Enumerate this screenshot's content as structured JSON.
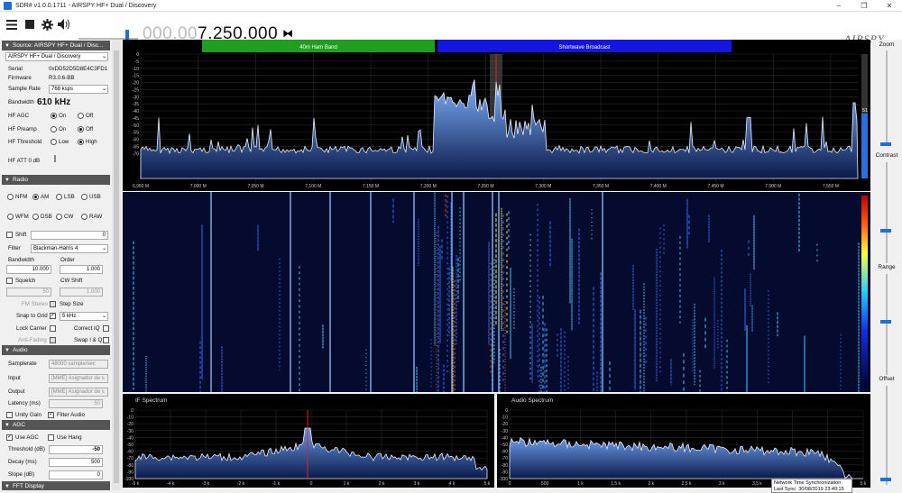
{
  "window": {
    "title": "SDR# v1.0.0.1711 - AIRSPY HF+ Dual / Discovery",
    "min": "–",
    "max": "❐",
    "close": "✕"
  },
  "toolbar": {
    "freq_dim": "000.00",
    "freq_lit": "7.250.000",
    "logo": "AIRSPY"
  },
  "source": {
    "header": "Source: AIRSPY HF+ Dual / Disc...",
    "device": "AIRSPY HF+ Dual / Discovery",
    "serial_label": "Serial",
    "serial": "0xDD52D5D8E4C3FD1",
    "firmware_label": "Firmware",
    "firmware": "R3.0.6-BB",
    "samplerate_label": "Sample Rate",
    "samplerate": "768 ksps",
    "bandwidth_label": "Bandwidth",
    "bandwidth": "610 kHz",
    "agc_label": "HF AGC",
    "preamp_label": "HF Preamp",
    "threshold_label": "HF Threshold",
    "on": "On",
    "off": "Off",
    "low": "Low",
    "high": "High",
    "att_label": "HF ATT 0 dB"
  },
  "radio": {
    "header": "Radio",
    "modes_row1": [
      "NFM",
      "AM",
      "LSB",
      "USB"
    ],
    "modes_row2": [
      "WFM",
      "DSB",
      "CW",
      "RAW"
    ],
    "shift_label": "Shift",
    "shift_value": "0",
    "filter_label": "Filter",
    "filter": "Blackman-Harris 4",
    "bandwidth_label": "Bandwidth",
    "bandwidth": "10.000",
    "order_label": "Order",
    "order": "1.000",
    "squelch_label": "Squelch",
    "squelch": "50",
    "cwshift_label": "CW Shift",
    "cwshift": "1.000",
    "fmstereo_label": "FM Stereo",
    "stepsize_label": "Step Size",
    "snap_label": "Snap to Grid",
    "step": "5 kHz",
    "lockcarrier_label": "Lock Carrier",
    "correctiq_label": "Correct IQ",
    "antifading_label": "Anti-Fading",
    "swapiq_label": "Swap I & Q"
  },
  "audio": {
    "header": "Audio",
    "samplerate_label": "Samplerate",
    "samplerate": "48000 sample/sec",
    "input_label": "Input",
    "input": "[MME] Asignador de s",
    "output_label": "Output",
    "output": "[MME] Asignador de s",
    "latency_label": "Latency (ms)",
    "latency": "50",
    "unity_label": "Unity Gain",
    "filteraudio_label": "Filter Audio"
  },
  "agc": {
    "header": "AGC",
    "useagc_label": "Use AGC",
    "usehang_label": "Use Hang",
    "threshold_label": "Threshold (dB)",
    "threshold": "-50",
    "decay_label": "Decay (ms)",
    "decay": "500",
    "slope_label": "Slope (dB)",
    "slope": "0"
  },
  "fft": {
    "header": "FFT Display"
  },
  "right": {
    "zoom": "Zoom",
    "contrast": "Contrast",
    "range": "Range",
    "offset": "Offset"
  },
  "spectrum": {
    "bands": [
      {
        "name": "40m Ham Band",
        "color": "#1f9e1f"
      },
      {
        "name": "Shortwave Broadcast",
        "color": "#1515e0"
      }
    ],
    "y_ticks": [
      "0",
      "-5",
      "-10",
      "-15",
      "-20",
      "-25",
      "-30",
      "-35",
      "-40",
      "-45",
      "-50",
      "-55",
      "-60",
      "-65",
      "-70"
    ],
    "x_ticks": [
      "6,950 M",
      "7,000 M",
      "7,050 M",
      "7,100 M",
      "7,150 M",
      "7,200 M",
      "7,250 M",
      "7,300 M",
      "7,350 M",
      "7,400 M",
      "7,450 M",
      "7,500 M",
      "7,550 M"
    ],
    "level_value": "51"
  },
  "if_spectrum": {
    "title": "IF Spectrum",
    "y_ticks": [
      "0",
      "-10",
      "-20",
      "-30",
      "-40",
      "-50",
      "-60",
      "-70",
      "-80",
      "-90",
      "-100"
    ],
    "x_ticks": [
      "-5 k",
      "-4 k",
      "-3 k",
      "-2 k",
      "-1 k",
      "0",
      "1 k",
      "2 k",
      "3 k",
      "4 k",
      "5 k"
    ]
  },
  "audio_spectrum": {
    "title": "Audio Spectrum",
    "y_ticks": [
      "0",
      "-10",
      "-20",
      "-30",
      "-40",
      "-50",
      "-60",
      "-70",
      "-80",
      "-90",
      "-100"
    ],
    "x_ticks": [
      "0",
      "500",
      "1 k",
      "1,5 k",
      "2 k",
      "2,5 k",
      "3 k",
      "3,5 k",
      "4 k",
      "4,5 k",
      "5 k"
    ]
  },
  "ntp": {
    "line1": "Network Time Synchronization",
    "line2": "Last Sync: 30/08/2019 23:40:15"
  }
}
